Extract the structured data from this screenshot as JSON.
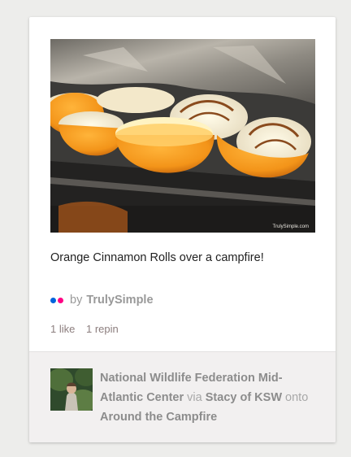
{
  "pin": {
    "image_alt": "Orange cinnamon rolls baked inside orange halves on a campfire grill",
    "watermark": "TrulySimple.com",
    "description": "Orange Cinnamon Rolls over a campfire!",
    "attribution": {
      "icon": "flickr-icon",
      "by_label": "by",
      "source": "TrulySimple",
      "colors": {
        "blue": "#0063dc",
        "pink": "#ff0084"
      }
    },
    "stats": {
      "likes": "1 like",
      "repins": "1 repin"
    }
  },
  "pinner": {
    "name": "National Wildlife Federation Mid-Atlantic Center",
    "via_label": "via",
    "via_user": "Stacy of KSW",
    "onto_label": "onto",
    "board": "Around the Campfire"
  }
}
